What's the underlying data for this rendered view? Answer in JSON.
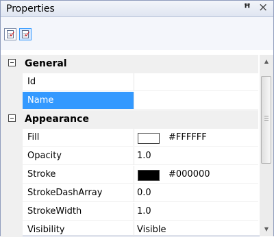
{
  "panel": {
    "title": "Properties",
    "pin_glyph": "ҁ",
    "close_glyph": "×"
  },
  "toolbar": {
    "buttons": [
      {
        "icon": "categorized-view-icon",
        "pressed": false
      },
      {
        "icon": "alphabetical-view-icon",
        "pressed": true
      }
    ]
  },
  "categories": [
    {
      "label": "General",
      "expander_icon": "collapse-icon",
      "properties": [
        {
          "name": "Id",
          "value": "",
          "selected": false
        },
        {
          "name": "Name",
          "value": "",
          "selected": true
        }
      ]
    },
    {
      "label": "Appearance",
      "expander_icon": "collapse-icon",
      "properties": [
        {
          "name": "Fill",
          "value": "#FFFFFF",
          "swatch": "#FFFFFF"
        },
        {
          "name": "Opacity",
          "value": "1.0"
        },
        {
          "name": "Stroke",
          "value": "#000000",
          "swatch": "#000000"
        },
        {
          "name": "StrokeDashArray",
          "value": "0.0"
        },
        {
          "name": "StrokeWidth",
          "value": "1.0"
        },
        {
          "name": "Visibility",
          "value": "Visible"
        }
      ]
    }
  ],
  "colors": {
    "selection": "#3399ff",
    "gutter": "#f0f0f0"
  }
}
